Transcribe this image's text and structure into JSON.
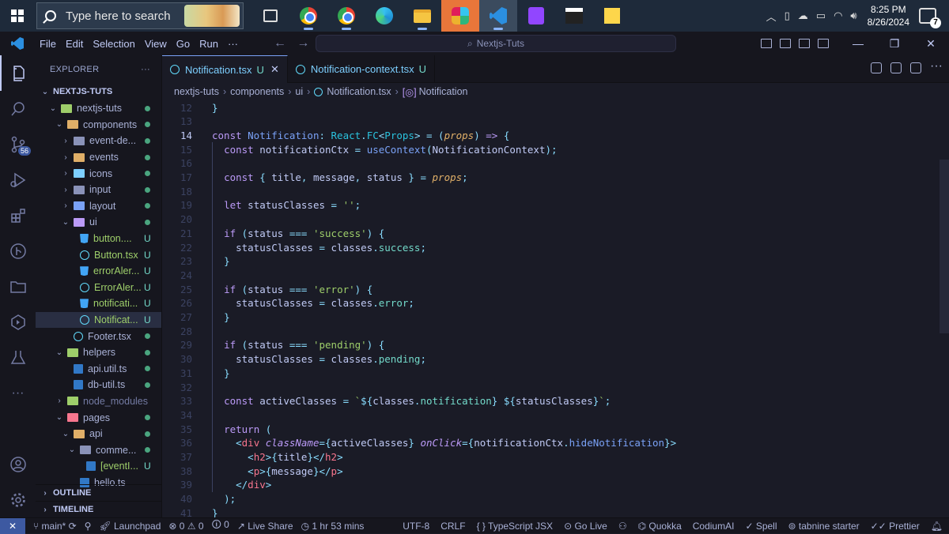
{
  "taskbar": {
    "search_placeholder": "Type here to search",
    "time": "8:25 PM",
    "date": "8/26/2024",
    "notification_count": "7"
  },
  "titlebar": {
    "menus": [
      "File",
      "Edit",
      "Selection",
      "View",
      "Go",
      "Run",
      "···"
    ],
    "search_label": "Nextjs-Tuts",
    "minimize": "—",
    "restore": "❐",
    "close": "✕"
  },
  "activity": {
    "source_control_badge": "56"
  },
  "explorer": {
    "header": "EXPLORER",
    "more": "···",
    "root": "NEXTJS-TUTS",
    "outline": "OUTLINE",
    "timeline": "TIMELINE",
    "tree": [
      {
        "name": "nextjs-tuts",
        "depth": 1,
        "kind": "folder",
        "open": true,
        "color": "f-green",
        "status": "dot"
      },
      {
        "name": "components",
        "depth": 2,
        "kind": "folder",
        "open": true,
        "color": "f-yellow",
        "status": "dot"
      },
      {
        "name": "event-de...",
        "depth": 3,
        "kind": "folder",
        "open": false,
        "color": "f-gray",
        "status": "dot"
      },
      {
        "name": "events",
        "depth": 3,
        "kind": "folder",
        "open": false,
        "color": "f-yellow",
        "status": "dot"
      },
      {
        "name": "icons",
        "depth": 3,
        "kind": "folder",
        "open": false,
        "color": "f-cyan",
        "status": "dot"
      },
      {
        "name": "input",
        "depth": 3,
        "kind": "folder",
        "open": false,
        "color": "f-gray",
        "status": "dot"
      },
      {
        "name": "layout",
        "depth": 3,
        "kind": "folder",
        "open": false,
        "color": "f-blue",
        "status": "dot"
      },
      {
        "name": "ui",
        "depth": 3,
        "kind": "folder",
        "open": true,
        "color": "f-purple",
        "status": "dot"
      },
      {
        "name": "button....",
        "depth": 4,
        "kind": "css",
        "status": "U"
      },
      {
        "name": "Button.tsx",
        "depth": 4,
        "kind": "react",
        "status": "U"
      },
      {
        "name": "errorAler...",
        "depth": 4,
        "kind": "css",
        "status": "U"
      },
      {
        "name": "ErrorAler...",
        "depth": 4,
        "kind": "react",
        "status": "U"
      },
      {
        "name": "notificati...",
        "depth": 4,
        "kind": "css",
        "status": "U"
      },
      {
        "name": "Notificat...",
        "depth": 4,
        "kind": "react",
        "status": "U",
        "selected": true
      },
      {
        "name": "Footer.tsx",
        "depth": 3,
        "kind": "react",
        "status": "dot"
      },
      {
        "name": "helpers",
        "depth": 2,
        "kind": "folder",
        "open": true,
        "color": "f-green",
        "status": "dot"
      },
      {
        "name": "api.util.ts",
        "depth": 3,
        "kind": "ts",
        "status": "dot"
      },
      {
        "name": "db-util.ts",
        "depth": 3,
        "kind": "ts",
        "status": "dot"
      },
      {
        "name": "node_modules",
        "depth": 2,
        "kind": "folder",
        "open": false,
        "color": "f-green",
        "status": "none",
        "dim": true
      },
      {
        "name": "pages",
        "depth": 2,
        "kind": "folder",
        "open": true,
        "color": "f-red",
        "status": "dot"
      },
      {
        "name": "api",
        "depth": 3,
        "kind": "folder",
        "open": true,
        "color": "f-yellow",
        "status": "dot"
      },
      {
        "name": "comme...",
        "depth": 4,
        "kind": "folder",
        "open": true,
        "color": "f-gray",
        "status": "dot"
      },
      {
        "name": "[eventI...",
        "depth": 5,
        "kind": "ts",
        "status": "U"
      },
      {
        "name": "hello.ts",
        "depth": 4,
        "kind": "ts",
        "status": "none"
      }
    ]
  },
  "tabs": [
    {
      "label": "Notification.tsx",
      "status": "U",
      "active": true,
      "close": "✕"
    },
    {
      "label": "Notification-context.tsx",
      "status": "U",
      "active": false
    }
  ],
  "breadcrumb": [
    "nextjs-tuts",
    "components",
    "ui",
    "Notification.tsx",
    "Notification"
  ],
  "editor": {
    "current_line": 14,
    "lines": [
      {
        "n": 12,
        "t": [
          [
            "p",
            "}"
          ]
        ]
      },
      {
        "n": 13,
        "t": []
      },
      {
        "n": 14,
        "t": [
          [
            "k",
            "const "
          ],
          [
            "fn",
            "Notification"
          ],
          [
            "p",
            ": "
          ],
          [
            "ty",
            "React"
          ],
          [
            "p",
            "."
          ],
          [
            "ty",
            "FC"
          ],
          [
            "p",
            "<"
          ],
          [
            "ty",
            "Props"
          ],
          [
            "p",
            "> = ("
          ],
          [
            "it",
            "props"
          ],
          [
            "p",
            ") "
          ],
          [
            "k",
            "=>"
          ],
          [
            "p",
            " {"
          ]
        ]
      },
      {
        "n": 15,
        "t": [
          [
            "pl",
            "  "
          ],
          [
            "k",
            "const "
          ],
          [
            "v",
            "notificationCtx"
          ],
          [
            "p",
            " = "
          ],
          [
            "fn",
            "useContext"
          ],
          [
            "p",
            "("
          ],
          [
            "v",
            "NotificationContext"
          ],
          [
            "p",
            ");"
          ]
        ]
      },
      {
        "n": 16,
        "t": []
      },
      {
        "n": 17,
        "t": [
          [
            "pl",
            "  "
          ],
          [
            "k",
            "const "
          ],
          [
            "p",
            "{ "
          ],
          [
            "v",
            "title"
          ],
          [
            "p",
            ", "
          ],
          [
            "v",
            "message"
          ],
          [
            "p",
            ", "
          ],
          [
            "v",
            "status"
          ],
          [
            "p",
            " } = "
          ],
          [
            "it",
            "props"
          ],
          [
            "p",
            ";"
          ]
        ]
      },
      {
        "n": 18,
        "t": []
      },
      {
        "n": 19,
        "t": [
          [
            "pl",
            "  "
          ],
          [
            "k",
            "let "
          ],
          [
            "v",
            "statusClasses"
          ],
          [
            "p",
            " = "
          ],
          [
            "s",
            "''"
          ],
          [
            "p",
            ";"
          ]
        ]
      },
      {
        "n": 20,
        "t": []
      },
      {
        "n": 21,
        "t": [
          [
            "pl",
            "  "
          ],
          [
            "k",
            "if "
          ],
          [
            "p",
            "("
          ],
          [
            "v",
            "status"
          ],
          [
            "p",
            " === "
          ],
          [
            "s",
            "'success'"
          ],
          [
            "p",
            ") {"
          ]
        ]
      },
      {
        "n": 22,
        "t": [
          [
            "pl",
            "    "
          ],
          [
            "v",
            "statusClasses"
          ],
          [
            "p",
            " = "
          ],
          [
            "v",
            "classes"
          ],
          [
            "p",
            "."
          ],
          [
            "pr",
            "success"
          ],
          [
            "p",
            ";"
          ]
        ]
      },
      {
        "n": 23,
        "t": [
          [
            "pl",
            "  "
          ],
          [
            "p",
            "}"
          ]
        ]
      },
      {
        "n": 24,
        "t": []
      },
      {
        "n": 25,
        "t": [
          [
            "pl",
            "  "
          ],
          [
            "k",
            "if "
          ],
          [
            "p",
            "("
          ],
          [
            "v",
            "status"
          ],
          [
            "p",
            " === "
          ],
          [
            "s",
            "'error'"
          ],
          [
            "p",
            ") {"
          ]
        ]
      },
      {
        "n": 26,
        "t": [
          [
            "pl",
            "    "
          ],
          [
            "v",
            "statusClasses"
          ],
          [
            "p",
            " = "
          ],
          [
            "v",
            "classes"
          ],
          [
            "p",
            "."
          ],
          [
            "pr",
            "error"
          ],
          [
            "p",
            ";"
          ]
        ]
      },
      {
        "n": 27,
        "t": [
          [
            "pl",
            "  "
          ],
          [
            "p",
            "}"
          ]
        ]
      },
      {
        "n": 28,
        "t": []
      },
      {
        "n": 29,
        "t": [
          [
            "pl",
            "  "
          ],
          [
            "k",
            "if "
          ],
          [
            "p",
            "("
          ],
          [
            "v",
            "status"
          ],
          [
            "p",
            " === "
          ],
          [
            "s",
            "'pending'"
          ],
          [
            "p",
            ") {"
          ]
        ]
      },
      {
        "n": 30,
        "t": [
          [
            "pl",
            "    "
          ],
          [
            "v",
            "statusClasses"
          ],
          [
            "p",
            " = "
          ],
          [
            "v",
            "classes"
          ],
          [
            "p",
            "."
          ],
          [
            "pr",
            "pending"
          ],
          [
            "p",
            ";"
          ]
        ]
      },
      {
        "n": 31,
        "t": [
          [
            "pl",
            "  "
          ],
          [
            "p",
            "}"
          ]
        ]
      },
      {
        "n": 32,
        "t": []
      },
      {
        "n": 33,
        "t": [
          [
            "pl",
            "  "
          ],
          [
            "k",
            "const "
          ],
          [
            "v",
            "activeClasses"
          ],
          [
            "p",
            " = "
          ],
          [
            "s",
            "`"
          ],
          [
            "p",
            "${"
          ],
          [
            "v",
            "classes"
          ],
          [
            "p",
            "."
          ],
          [
            "pr",
            "notification"
          ],
          [
            "p",
            "}"
          ],
          [
            "s",
            " "
          ],
          [
            "p",
            "${"
          ],
          [
            "v",
            "statusClasses"
          ],
          [
            "p",
            "}"
          ],
          [
            "s",
            "`"
          ],
          [
            "p",
            ";"
          ]
        ]
      },
      {
        "n": 34,
        "t": []
      },
      {
        "n": 35,
        "t": [
          [
            "pl",
            "  "
          ],
          [
            "k",
            "return "
          ],
          [
            "p",
            "("
          ]
        ]
      },
      {
        "n": 36,
        "t": [
          [
            "pl",
            "    "
          ],
          [
            "p",
            "<"
          ],
          [
            "tg",
            "div "
          ],
          [
            "at",
            "className"
          ],
          [
            "p",
            "={"
          ],
          [
            "v",
            "activeClasses"
          ],
          [
            "p",
            "} "
          ],
          [
            "at",
            "onClick"
          ],
          [
            "p",
            "={"
          ],
          [
            "v",
            "notificationCtx"
          ],
          [
            "p",
            "."
          ],
          [
            "fn",
            "hideNotification"
          ],
          [
            "p",
            "}>"
          ]
        ]
      },
      {
        "n": 37,
        "t": [
          [
            "pl",
            "      "
          ],
          [
            "p",
            "<"
          ],
          [
            "tg",
            "h2"
          ],
          [
            "p",
            ">{"
          ],
          [
            "v",
            "title"
          ],
          [
            "p",
            "}</"
          ],
          [
            "tg",
            "h2"
          ],
          [
            "p",
            ">"
          ]
        ]
      },
      {
        "n": 38,
        "t": [
          [
            "pl",
            "      "
          ],
          [
            "p",
            "<"
          ],
          [
            "tg",
            "p"
          ],
          [
            "p",
            ">{"
          ],
          [
            "v",
            "message"
          ],
          [
            "p",
            "}</"
          ],
          [
            "tg",
            "p"
          ],
          [
            "p",
            ">"
          ]
        ]
      },
      {
        "n": 39,
        "t": [
          [
            "pl",
            "    "
          ],
          [
            "p",
            "</"
          ],
          [
            "tg",
            "div"
          ],
          [
            "p",
            ">"
          ]
        ]
      },
      {
        "n": 40,
        "t": [
          [
            "pl",
            "  "
          ],
          [
            "p",
            ");"
          ]
        ]
      },
      {
        "n": 41,
        "t": [
          [
            "p",
            "}"
          ]
        ]
      }
    ]
  },
  "statusbar": {
    "remote": "✕",
    "branch": "main*",
    "launchpad": "Launchpad",
    "problems": "⊗ 0 ⚠ 0",
    "ports": "🛈 0",
    "live_share": "Live Share",
    "time_spent": "1 hr 53 mins",
    "encoding": "UTF-8",
    "eol": "CRLF",
    "language": "{ } TypeScript JSX",
    "go_live": "Go Live",
    "quokka": "Quokka",
    "codium": "CodiumAI",
    "spell": "Spell",
    "tabnine": "tabnine starter",
    "prettier": "Prettier"
  },
  "colors": {
    "editor_bg": "#1a1b26",
    "sidebar_bg": "#16161e",
    "keyword": "#bb9af7",
    "function": "#7aa2f7",
    "string": "#9ece6a",
    "git_untracked": "#73daca"
  }
}
